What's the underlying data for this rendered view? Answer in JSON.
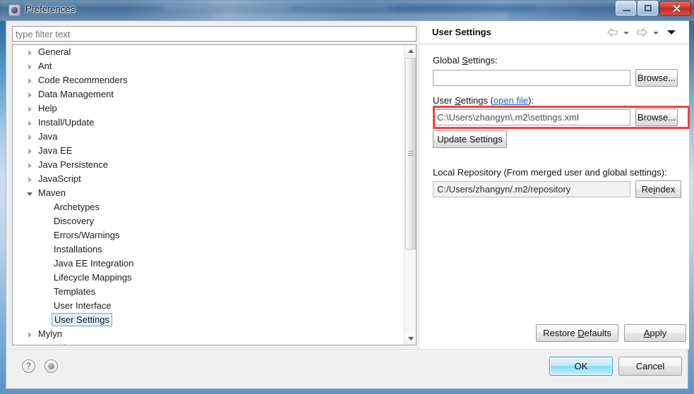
{
  "window": {
    "title": "Preferences",
    "icon": "preferences-icon",
    "caption_buttons": {
      "minimize": "minimize-button",
      "maximize": "maximize-button",
      "close": "close-button"
    }
  },
  "filter": {
    "placeholder": "type filter text",
    "value": ""
  },
  "tree": {
    "items": [
      {
        "label": "General",
        "level": 1,
        "state": "collapsed",
        "selected": false
      },
      {
        "label": "Ant",
        "level": 1,
        "state": "collapsed",
        "selected": false
      },
      {
        "label": "Code Recommenders",
        "level": 1,
        "state": "collapsed",
        "selected": false
      },
      {
        "label": "Data Management",
        "level": 1,
        "state": "collapsed",
        "selected": false
      },
      {
        "label": "Help",
        "level": 1,
        "state": "collapsed",
        "selected": false
      },
      {
        "label": "Install/Update",
        "level": 1,
        "state": "collapsed",
        "selected": false
      },
      {
        "label": "Java",
        "level": 1,
        "state": "collapsed",
        "selected": false
      },
      {
        "label": "Java EE",
        "level": 1,
        "state": "collapsed",
        "selected": false
      },
      {
        "label": "Java Persistence",
        "level": 1,
        "state": "collapsed",
        "selected": false
      },
      {
        "label": "JavaScript",
        "level": 1,
        "state": "collapsed",
        "selected": false
      },
      {
        "label": "Maven",
        "level": 1,
        "state": "expanded",
        "selected": false
      },
      {
        "label": "Archetypes",
        "level": 2,
        "state": "leaf",
        "selected": false
      },
      {
        "label": "Discovery",
        "level": 2,
        "state": "leaf",
        "selected": false
      },
      {
        "label": "Errors/Warnings",
        "level": 2,
        "state": "leaf",
        "selected": false
      },
      {
        "label": "Installations",
        "level": 2,
        "state": "leaf",
        "selected": false
      },
      {
        "label": "Java EE Integration",
        "level": 2,
        "state": "leaf",
        "selected": false
      },
      {
        "label": "Lifecycle Mappings",
        "level": 2,
        "state": "leaf",
        "selected": false
      },
      {
        "label": "Templates",
        "level": 2,
        "state": "leaf",
        "selected": false
      },
      {
        "label": "User Interface",
        "level": 2,
        "state": "leaf",
        "selected": false
      },
      {
        "label": "User Settings",
        "level": 2,
        "state": "leaf",
        "selected": true
      },
      {
        "label": "Mylyn",
        "level": 1,
        "state": "collapsed",
        "selected": false
      },
      {
        "label": "Oomph",
        "level": 1,
        "state": "collapsed",
        "selected": false
      }
    ]
  },
  "page": {
    "title": "User Settings",
    "nav": {
      "back": "back-arrow",
      "back_menu": "back-dropdown",
      "forward": "forward-arrow",
      "forward_menu": "forward-dropdown",
      "view_menu": "view-menu"
    },
    "global_settings": {
      "label_pre": "Global ",
      "label_mnemonic": "S",
      "label_post": "ettings:",
      "value": "",
      "browse_label": "Browse..."
    },
    "user_settings": {
      "label_pre": "User ",
      "label_mnemonic": "S",
      "label_mid": "ettings (",
      "link": "open file",
      "label_post": "):",
      "value": "C:\\Users\\zhangyn\\.m2\\settings.xml",
      "browse_label": "Browse...",
      "update_label": "Update Settings"
    },
    "local_repository": {
      "label": "Local Repository (From merged user and global settings):",
      "value": "C:/Users/zhangyn/.m2/repository",
      "reindex_pre": "Re",
      "reindex_mnemonic": "i",
      "reindex_post": "ndex"
    },
    "restore_defaults": {
      "pre": "Restore ",
      "mnemonic": "D",
      "post": "efaults"
    },
    "apply": {
      "mnemonic": "A",
      "post": "pply"
    }
  },
  "footer": {
    "help_icon": "?",
    "oomph_icon": "oomph-icon",
    "ok_label": "OK",
    "cancel_label": "Cancel"
  },
  "annotation": {
    "color": "#f4403a",
    "target": "user-settings-path-row"
  }
}
